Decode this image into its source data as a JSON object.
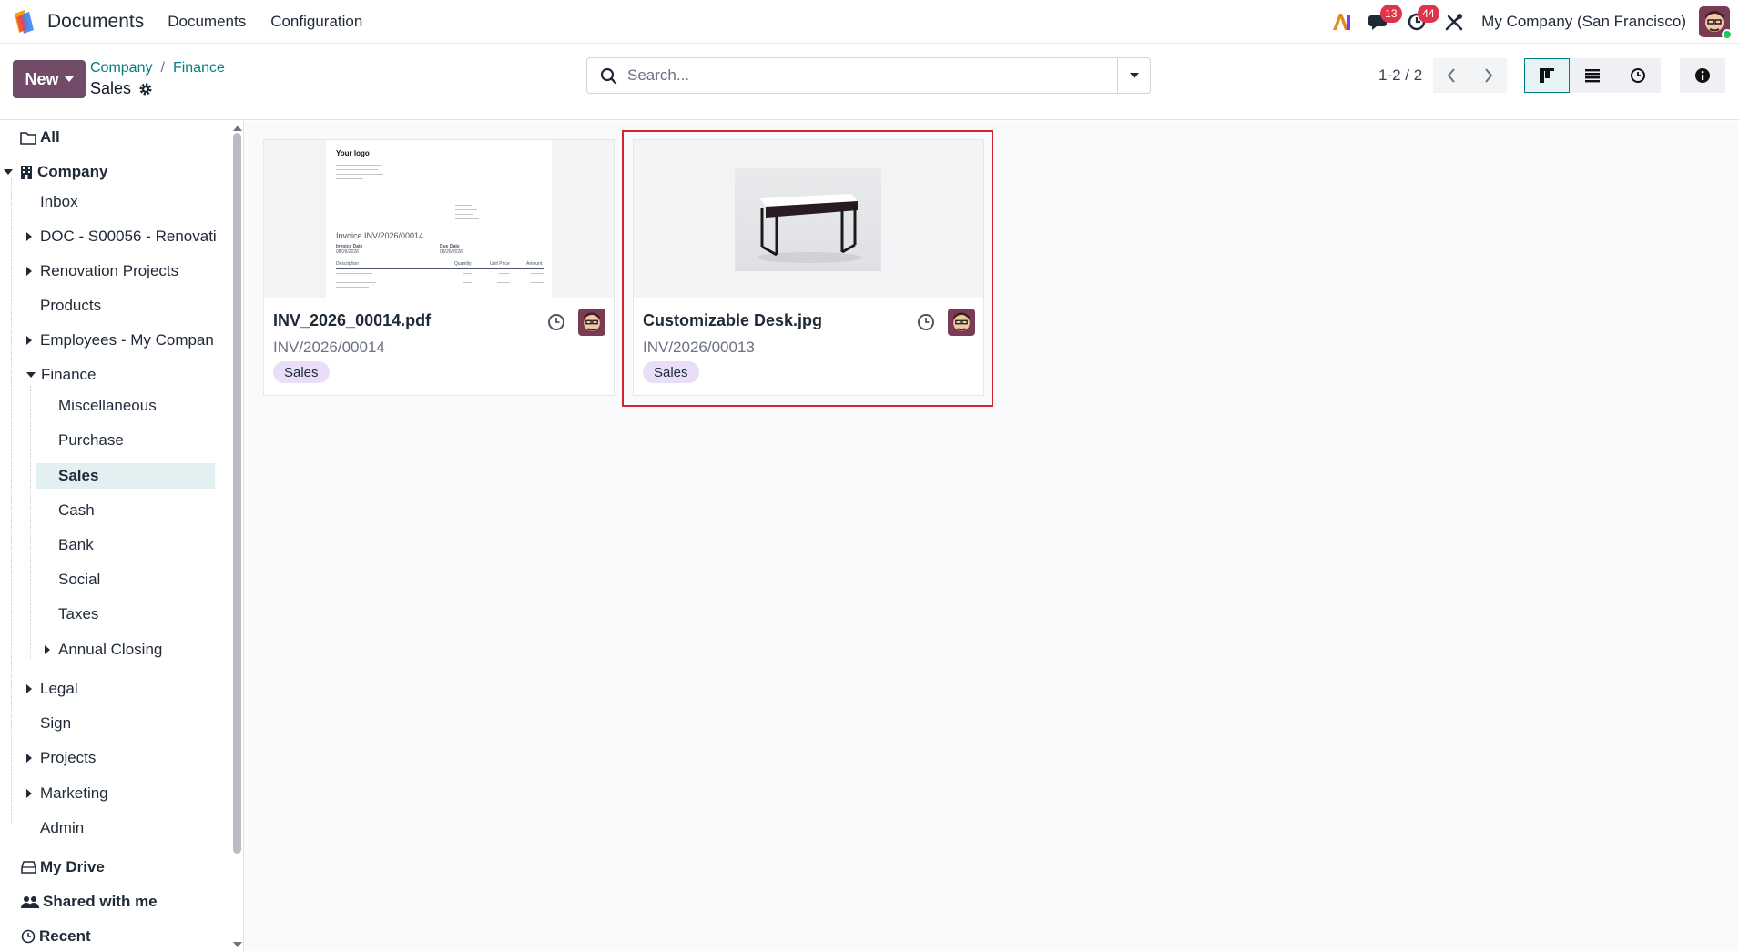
{
  "navbar": {
    "app_name": "Documents",
    "menu": [
      "Documents",
      "Configuration"
    ],
    "chat_count": "13",
    "activity_count": "44",
    "company": "My Company (San Francisco)"
  },
  "control_panel": {
    "new_label": "New",
    "breadcrumb": [
      "Company",
      "Finance"
    ],
    "current": "Sales",
    "search_placeholder": "Search...",
    "pager": "1-2 / 2"
  },
  "sidebar": {
    "all": "All",
    "company": "Company",
    "inbox": "Inbox",
    "doc": "DOC - S00056 - Renovati",
    "renovation": "Renovation Projects",
    "products": "Products",
    "employees": "Employees - My Compan",
    "finance": "Finance",
    "misc": "Miscellaneous",
    "purchase": "Purchase",
    "sales": "Sales",
    "cash": "Cash",
    "bank": "Bank",
    "social": "Social",
    "taxes": "Taxes",
    "annual": "Annual Closing",
    "legal": "Legal",
    "sign": "Sign",
    "projects": "Projects",
    "marketing": "Marketing",
    "admin": "Admin",
    "my_drive": "My Drive",
    "shared": "Shared with me",
    "recent": "Recent"
  },
  "documents": [
    {
      "name": "INV_2026_00014.pdf",
      "ref": "INV/2026/00014",
      "tag": "Sales"
    },
    {
      "name": "Customizable Desk.jpg",
      "ref": "INV/2026/00013",
      "tag": "Sales"
    }
  ],
  "pdf_preview": {
    "logo": "Your logo",
    "title": "Invoice INV/2026/00014",
    "invoice_date_label": "Invoice Date",
    "due_date_label": "Due Date",
    "invoice_date": "08/26/2026",
    "due_date": "08/26/2026",
    "col_description": "Description",
    "col_quantity": "Quantity",
    "col_unit_price": "Unit Price",
    "col_amount": "Amount"
  },
  "colors": {
    "brand": "#714b67",
    "link": "#017e84",
    "badge": "#e0344a",
    "highlight": "#d6242e",
    "tag": "#e8def8"
  }
}
